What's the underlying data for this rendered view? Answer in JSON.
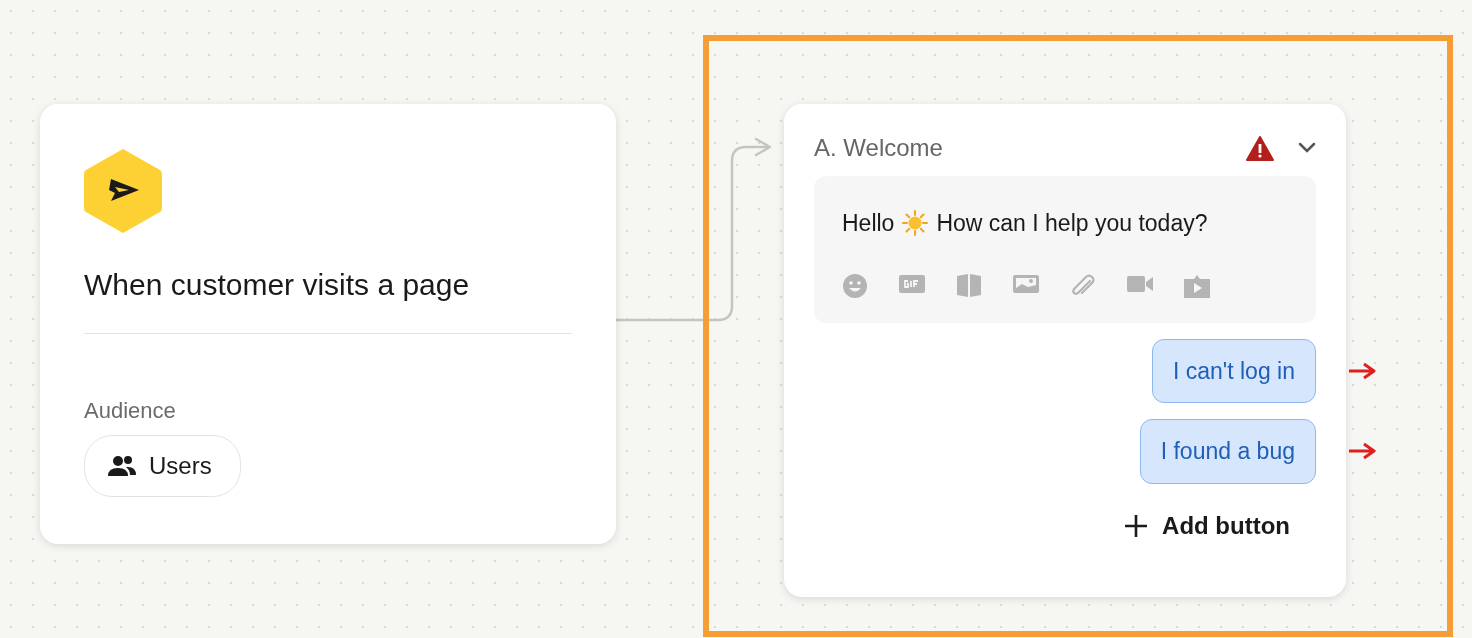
{
  "trigger": {
    "title": "When customer visits a page",
    "audience_label": "Audience",
    "audience": "Users"
  },
  "step": {
    "title": "A. Welcome",
    "warning": true,
    "selected": true,
    "message_parts": [
      "Hello",
      "How can I help you today?"
    ],
    "reply_buttons": [
      {
        "label": "I can't log in"
      },
      {
        "label": "I found a bug"
      }
    ],
    "add_button": "Add button"
  }
}
